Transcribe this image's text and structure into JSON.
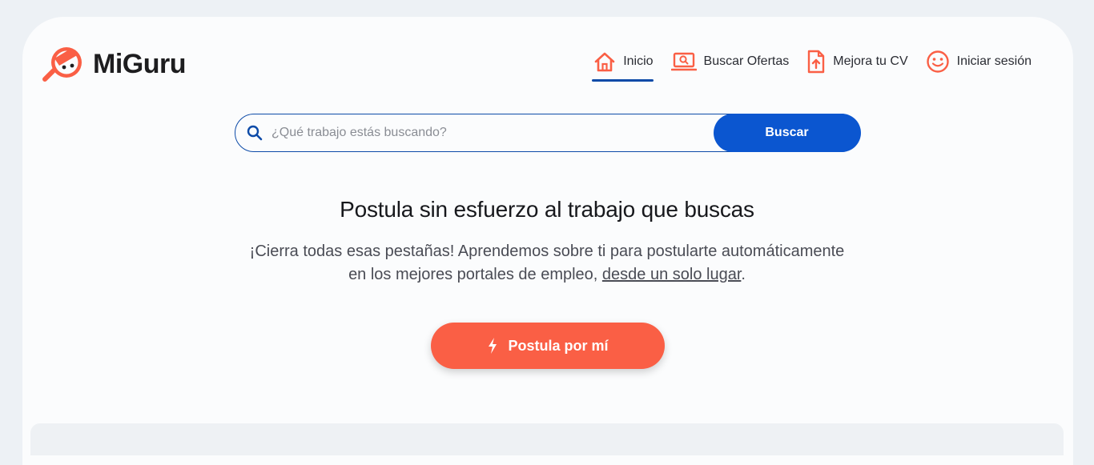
{
  "brand": {
    "name": "MiGuru",
    "logo_icon": "magnifier-face-logo",
    "accent_color": "#fa5f45",
    "primary_color": "#0b56d0"
  },
  "nav": {
    "items": [
      {
        "label": "Inicio",
        "icon": "home-icon",
        "active": true
      },
      {
        "label": "Buscar Ofertas",
        "icon": "laptop-search-icon",
        "active": false
      },
      {
        "label": "Mejora tu CV",
        "icon": "file-upload-icon",
        "active": false
      },
      {
        "label": "Iniciar sesión",
        "icon": "smiley-icon",
        "active": false
      }
    ]
  },
  "search": {
    "placeholder": "¿Qué trabajo estás buscando?",
    "value": "",
    "button_label": "Buscar"
  },
  "hero": {
    "title": "Postula sin esfuerzo al trabajo que buscas",
    "subtitle_line1": "¡Cierra todas esas pestañas! Aprendemos sobre ti para postularte automáticamente",
    "subtitle_line2_prefix": "en los mejores portales de empleo, ",
    "subtitle_link": "desde un solo lugar",
    "subtitle_line2_suffix": ".",
    "cta_label": "Postula por mí"
  }
}
